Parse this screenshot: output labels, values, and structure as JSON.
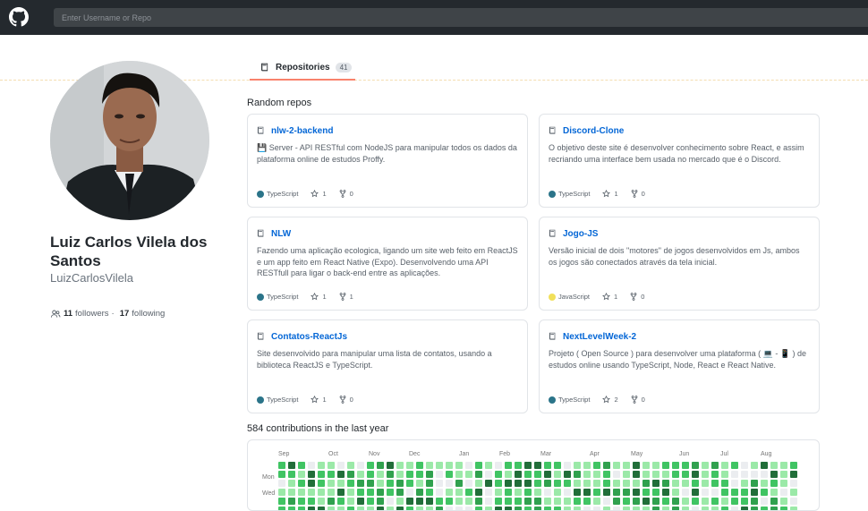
{
  "search": {
    "placeholder": "Enter Username or Repo"
  },
  "tab": {
    "label": "Repositories",
    "count": "41"
  },
  "profile": {
    "name": "Luiz Carlos Vilela dos Santos",
    "login": "LuizCarlosVilela",
    "followers_count": "11",
    "followers_label": "followers",
    "separator": "·",
    "following_count": "17",
    "following_label": "following"
  },
  "random_repos_title": "Random repos",
  "repos": [
    {
      "name": "nlw-2-backend",
      "description": "💾 Server - API RESTful com NodeJS para manipular todos os dados da plataforma online de estudos Proffy.",
      "language": "TypeScript",
      "language_color": "#2b7489",
      "stars": "1",
      "forks": "0"
    },
    {
      "name": "Discord-Clone",
      "description": "O objetivo deste site é desenvolver conhecimento sobre React, e assim recriando uma interface bem usada no mercado que é o Discord.",
      "language": "TypeScript",
      "language_color": "#2b7489",
      "stars": "1",
      "forks": "0"
    },
    {
      "name": "NLW",
      "description": "Fazendo uma aplicação ecologica, ligando um site web feito em ReactJS e um app feito em React Native (Expo). Desenvolvendo uma API RESTfull para ligar o back-end entre as aplicações.",
      "language": "TypeScript",
      "language_color": "#2b7489",
      "stars": "1",
      "forks": "1"
    },
    {
      "name": "Jogo-JS",
      "description": "Versão inicial de dois \"motores\" de jogos desenvolvidos em Js, ambos os jogos são conectados através da tela inicial.",
      "language": "JavaScript",
      "language_color": "#f1e05a",
      "stars": "1",
      "forks": "0"
    },
    {
      "name": "Contatos-ReactJs",
      "description": "Site desenvolvido para manipular uma lista de contatos, usando a biblioteca ReactJS e TypeScript.",
      "language": "TypeScript",
      "language_color": "#2b7489",
      "stars": "1",
      "forks": "0"
    },
    {
      "name": "NextLevelWeek-2",
      "description": "Projeto ( Open Source ) para desenvolver uma plataforma ( 💻 - 📱 ) de estudos online usando TypeScript, Node, React e React Native.",
      "language": "TypeScript",
      "language_color": "#2b7489",
      "stars": "2",
      "forks": "0"
    }
  ],
  "contributions": {
    "title": "584 contributions in the last year",
    "months": [
      "Sep",
      "Oct",
      "Nov",
      "Dec",
      "Jan",
      "Feb",
      "Mar",
      "Apr",
      "May",
      "Jun",
      "Jul",
      "Aug"
    ],
    "weekdays": [
      "Mon",
      "Wed"
    ],
    "colors": [
      "#ebedf0",
      "#9be9a8",
      "#40c463",
      "#30a14e",
      "#216e39"
    ]
  }
}
